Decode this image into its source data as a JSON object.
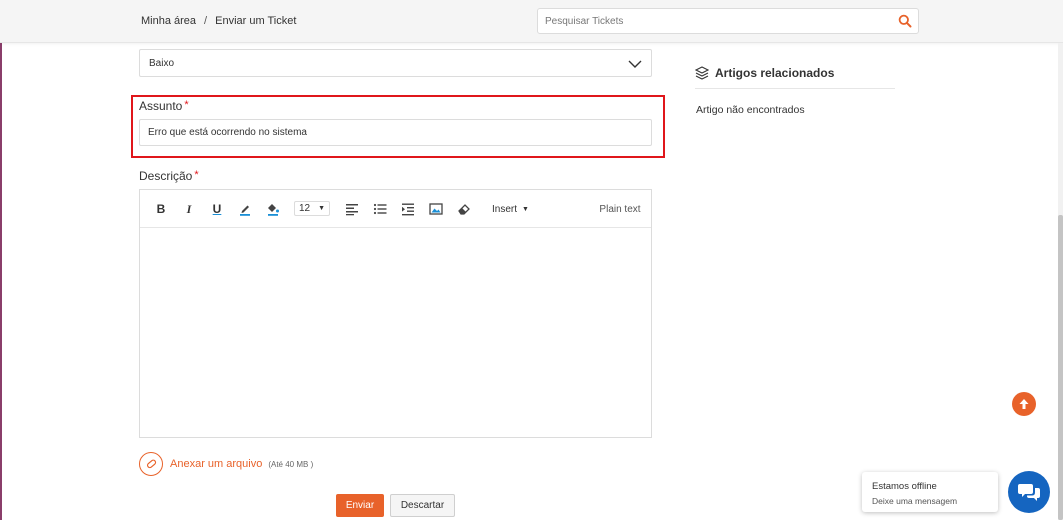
{
  "header": {
    "breadcrumb": [
      "Minha área",
      "Enviar um Ticket"
    ],
    "separator": "/",
    "search_placeholder": "Pesquisar Tickets"
  },
  "form": {
    "priority_value": "Baixo",
    "subject_label": "Assunto",
    "subject_required": "*",
    "subject_value": "Erro que está ocorrendo  no sistema",
    "description_label": "Descrição",
    "description_required": "*",
    "toolbar": {
      "bold": "B",
      "italic": "I",
      "underline": "U",
      "font_size": "12",
      "insert": "Insert",
      "plain_text": "Plain text"
    },
    "attach_label": "Anexar um arquivo",
    "attach_limit": "(Até 40 MB )",
    "send_label": "Enviar",
    "discard_label": "Descartar"
  },
  "related": {
    "title": "Artigos relacionados",
    "empty": "Artigo não encontrados"
  },
  "chat": {
    "status": "Estamos offline",
    "message": "Deixe uma mensagem"
  },
  "colors": {
    "accent": "#e8622a",
    "highlight": "#e0161b",
    "chat": "#1565c0"
  }
}
